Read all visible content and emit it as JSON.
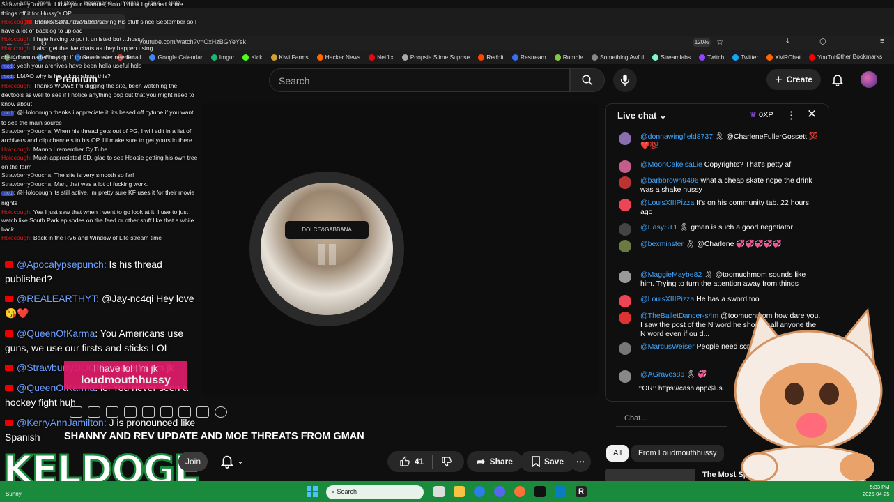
{
  "browser": {
    "menu": [
      "File",
      "Edit",
      "View",
      "History",
      "Bookmarks",
      "Profiles",
      "Tools",
      "Help"
    ],
    "tab_title": "SHANNY AND REV UPDATE",
    "url": "youtube.com/watch?v=OxHzBGYeYsk",
    "zoom": "120%",
    "bookmarks": [
      {
        "label": "4chan",
        "color": "#7aa35a"
      },
      {
        "label": "Bluesky",
        "color": "#1f86ff"
      },
      {
        "label": "Facebook",
        "color": "#1877f2"
      },
      {
        "label": "Gmail",
        "color": "#ea4335"
      },
      {
        "label": "Google Calendar",
        "color": "#4285f4"
      },
      {
        "label": "Imgur",
        "color": "#1bb76e"
      },
      {
        "label": "Kick",
        "color": "#53fc18"
      },
      {
        "label": "Kiwi Farms",
        "color": "#d0a030"
      },
      {
        "label": "Hacker News",
        "color": "#ff6600"
      },
      {
        "label": "Netflix",
        "color": "#e50914"
      },
      {
        "label": "Poopsie Slime Suprise",
        "color": "#aaaaaa"
      },
      {
        "label": "Reddit",
        "color": "#ff4500"
      },
      {
        "label": "Restream",
        "color": "#3a6df0"
      },
      {
        "label": "Rumble",
        "color": "#85c742"
      },
      {
        "label": "Something Awful",
        "color": "#888888"
      },
      {
        "label": "Streamlabs",
        "color": "#80f5d2"
      },
      {
        "label": "Twitch",
        "color": "#9146ff"
      },
      {
        "label": "Twitter",
        "color": "#1da1f2"
      },
      {
        "label": "XMRChat",
        "color": "#ff6600"
      },
      {
        "label": "YouTube",
        "color": "#ff0000"
      }
    ],
    "other_bookmarks": "Other Bookmarks"
  },
  "overlay_chat": [
    {
      "name": "StrawberryDoucha",
      "cls": "",
      "text": "I love your channel, Holo. I think I grabbed some things off it for Hussy's OP"
    },
    {
      "name": "Holocough",
      "cls": "red",
      "text": "Thanks SD. I have been saving his stuff since September so I have a lot of backlog to upload"
    },
    {
      "name": "Holocough",
      "cls": "red",
      "text": "I hate having to put it unlisted but ...hussy"
    },
    {
      "name": "Holocough",
      "cls": "red",
      "text": "I also get the live chats as they happen using chat_downloader or ytdlp if those are ever needed"
    },
    {
      "name": "mod",
      "cls": "blue",
      "text": "yeah your archives have been hella useful holo"
    },
    {
      "name": "mod",
      "cls": "blue",
      "text": "LMAO why is he talking about this?"
    },
    {
      "name": "Holocough",
      "cls": "red",
      "text": "Thanks WOW!! I'm digging the site, been watching the devtools as well to see if I notice anything pop out that you might need to know about"
    },
    {
      "name": "mod",
      "cls": "blue",
      "text": "@Holocough thanks i appreciate it, its based off cytube if you want to see the main source"
    },
    {
      "name": "StrawberryDoucha",
      "cls": "",
      "text": "When his thread gets out of PG, I will edit in a list of archivers and clip channels to his OP. I'll make sure to get yours in there."
    },
    {
      "name": "Holocough",
      "cls": "red",
      "text": "Mannn I remember Cy.Tube"
    },
    {
      "name": "Holocough",
      "cls": "red",
      "text": "Much appreciated SD, glad to see Hoosie getting his own tree on the farm"
    },
    {
      "name": "StrawberryDoucha",
      "cls": "",
      "text": "The site is very smooth so far!"
    },
    {
      "name": "StrawberryDoucha",
      "cls": "",
      "text": "Man, that was a lot of fucking work."
    },
    {
      "name": "mod",
      "cls": "blue",
      "text": "@Holocough its still active, im pretty sure KF uses it for their movie nights"
    },
    {
      "name": "Holocough",
      "cls": "red",
      "text": "Yea I just saw that when I went to go look at it. I use to just watch like South Park episodes on the feed or other stuff like that a while back"
    },
    {
      "name": "Holocough",
      "cls": "red",
      "text": "Back in the RV6 and Window of Life stream time"
    }
  ],
  "header": {
    "logo": "Premium",
    "search_placeholder": "Search",
    "create_label": "Create"
  },
  "stream_chat": [
    {
      "user": "@Apocalypsepunch",
      "text": " Is his thread published?"
    },
    {
      "user": "@REALEARTHYT",
      "text": " @Jay-nc4qi Hey love 😘❤️"
    },
    {
      "user": "@QueenOfKarma",
      "text": " You Americans use guns, we use our firsts and sticks LOL"
    },
    {
      "user": "@StrawburryDOOM",
      "text": " I have lol I'm jk"
    },
    {
      "user": "@QueenOfKarma",
      "text": " lol You never seen a hockey fight huh"
    },
    {
      "user": "@KerryAnnJamilton",
      "text": " J is pronounced like Spanish"
    }
  ],
  "donation": {
    "text": "I have lol I'm jk",
    "name": "loudmouthhussy"
  },
  "video": {
    "title": "SHANNY AND REV UPDATE AND MOE THREATS FROM GMAN",
    "glasses_text": "DOLCE&GABBANA",
    "join": "Join",
    "likes": "41",
    "share": "Share",
    "save": "Save"
  },
  "keldoge": "KELDOGE",
  "live_chat": {
    "title": "Live chat",
    "xp": "0XP",
    "messages": [
      {
        "name": "@donnawingfield8737",
        "text": " 🎗 @CharleneFullerGossett 💯❤️💯",
        "color": "#8a6fb0"
      },
      {
        "name": "@MoonCakeisaLie",
        "text": " Copyrights? That's petty af",
        "color": "#c45c8c"
      },
      {
        "name": "@barbbrown9496",
        "text": " what a cheap skate nope the drink was a shake hussy",
        "color": "#b33"
      },
      {
        "name": "@LouisXIIIPizza",
        "text": " It's on his community tab. 22 hours ago",
        "color": "#e45"
      },
      {
        "name": "@EasyST1",
        "text": " 🎗 gman is such a good negotiator",
        "color": "#444"
      },
      {
        "name": "@bexminster",
        "text": " 🎗 @Charlene 💞💞💞💞💞",
        "color": "#6a7a40"
      },
      {
        "name": "@MaggieMaybe82",
        "text": " 🎗 @toomuchmom sounds like him. Trying to turn the attention away from things",
        "color": "#999"
      },
      {
        "name": "@LouisXIIIPizza",
        "text": " He has a sword too",
        "color": "#e45"
      },
      {
        "name": "@TheBalletDancer-s4m",
        "text": " @toomuchmom how dare you. I saw the post of the N word he should call anyone the N word even if ou d...",
        "color": "#d33"
      },
      {
        "name": "@MarcusWeiser",
        "text": " People need screen shots lol",
        "color": "#777"
      },
      {
        "name": "@AGraves86",
        "text": " 🎗 💞",
        "color": "#888"
      }
    ],
    "link": "::OR:: https://cash.app/$lus...",
    "chat_placeholder": "Chat...",
    "filters": [
      "All",
      "From Loudmouthhussy"
    ],
    "recommendation": "The Most Spoil..."
  },
  "taskbar": {
    "search": "Search",
    "time": "5:33 PM",
    "date": "2026-04-25",
    "weather": "Sunny"
  }
}
